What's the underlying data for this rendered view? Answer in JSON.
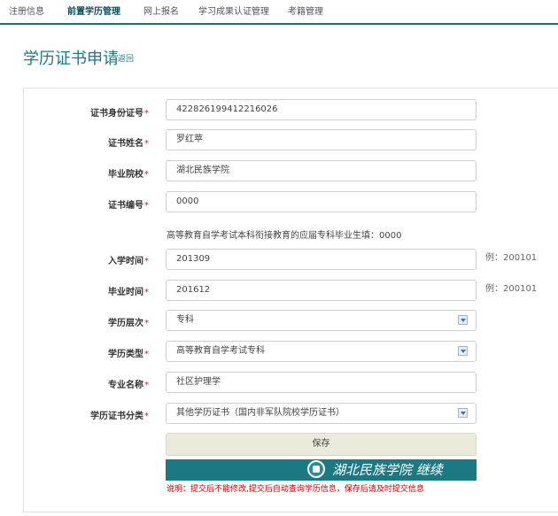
{
  "nav": {
    "items": [
      {
        "label": "注册信息",
        "active": false
      },
      {
        "label": "前置学历管理",
        "active": true
      },
      {
        "label": "网上报名",
        "active": false
      },
      {
        "label": "学习成果认证管理",
        "active": false
      },
      {
        "label": "考籍管理",
        "active": false
      }
    ],
    "accent_color": "#1d6f73"
  },
  "page": {
    "title": "学历证书申请",
    "back_label": "返回"
  },
  "form": {
    "required_mark": "*",
    "id_number": {
      "label": "证书身份证号",
      "value": "422826199412216026"
    },
    "name": {
      "label": "证书姓名",
      "value": "罗红苹"
    },
    "school": {
      "label": "毕业院校",
      "value": "湖北民族学院"
    },
    "cert_no": {
      "label": "证书编号",
      "value": "0000"
    },
    "hint": "高等教育自学考试本科衔接教育的应届专科毕业生填：0000",
    "enroll_time": {
      "label": "入学时间",
      "value": "201309",
      "example": "例：200101"
    },
    "grad_time": {
      "label": "毕业时间",
      "value": "201612",
      "example": "例：200101"
    },
    "level": {
      "label": "学历层次",
      "value": "专科"
    },
    "type": {
      "label": "学历类型",
      "value": "高等教育自学考试专科"
    },
    "major": {
      "label": "专业名称",
      "value": "社区护理学"
    },
    "category": {
      "label": "学历证书分类",
      "value": "其他学历证书（国内非军队院校学历证书）"
    },
    "save_label": "保存"
  },
  "banner": {
    "seal_icon": "school-seal-icon",
    "watermark_text": "湖北民族学院 继续",
    "color": "#1a7983"
  },
  "note": "说明：提交后不能修改,提交后自动查询学历信息，保存后请及时提交信息",
  "colors": {
    "required": "#d51d1d",
    "note": "#c20000",
    "title": "#1f7a7f"
  }
}
